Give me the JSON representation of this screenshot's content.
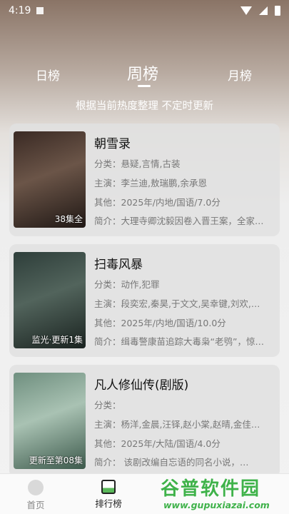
{
  "status_bar": {
    "time": "4:19"
  },
  "tabs": {
    "daily": "日榜",
    "weekly": "周榜",
    "monthly": "月榜"
  },
  "subtitle": "根据当前热度整理 不定时更新",
  "items": [
    {
      "title": "朝雪录",
      "category": "分类：悬疑,言情,古装",
      "cast": "主演：李兰迪,敖瑞鹏,余承恩",
      "other": "其他：2025年/内地/国语/7.0分",
      "intro": "简介：大理寺卿沈毅因卷入晋王案，全家…",
      "badge": "38集全",
      "poster_title": "朝雪录",
      "poster_colors": [
        "#3a2a24",
        "#6b5548",
        "#201815"
      ]
    },
    {
      "title": "扫毒风暴",
      "category": "分类：动作,犯罪",
      "cast": "主演：段奕宏,秦昊,于文文,吴幸键,刘欢,…",
      "other": "其他：2025年/内地/国语/10.0分",
      "intro": "简介：缉毒警康苗追踪大毒枭“老鸮”，惊…",
      "badge": "监光·更新1集",
      "poster_title": "扫毒风暴",
      "poster_colors": [
        "#2e3e3a",
        "#52645c",
        "#1a2320"
      ]
    },
    {
      "title": "凡人修仙传(剧版)",
      "category": "分类：",
      "cast": "主演：杨洋,金晨,汪铎,赵小棠,赵晴,金佳…",
      "other": "其他：2025年/大陆/国语/4.0分",
      "intro": "简介：      该剧改编自忘语的同名小说，…",
      "badge": "更新至第08集",
      "poster_title": "凡人修仙传",
      "poster_colors": [
        "#6f8f7f",
        "#a9c2b3",
        "#3d5a4c"
      ]
    }
  ],
  "bottom_nav": {
    "home": "首页",
    "rank": "排行榜"
  },
  "watermark": {
    "big": "谷普软件园",
    "small": "www.gupuxiazai.com"
  }
}
